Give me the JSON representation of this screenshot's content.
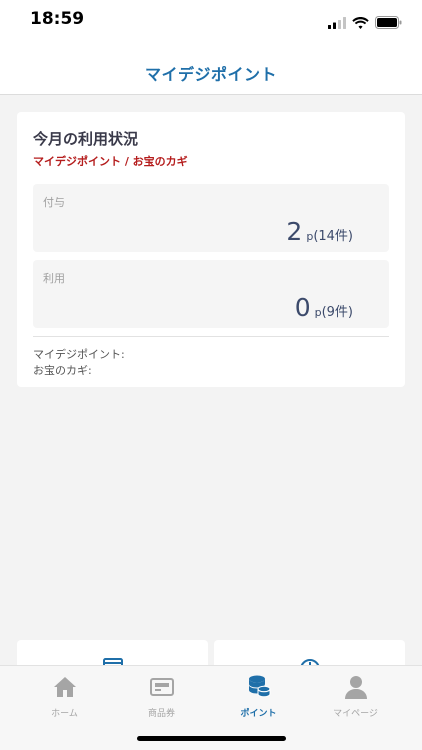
{
  "status_bar": {
    "time": "18:59"
  },
  "header": {
    "title": "マイデジポイント"
  },
  "usage_card": {
    "title": "今月の利用状況",
    "subtitle": "マイデジポイント / お宝のカギ",
    "grant": {
      "label": "付与",
      "value": "2",
      "unit": "p",
      "count": "(14件)"
    },
    "use": {
      "label": "利用",
      "value": "0",
      "unit": "p",
      "count": "(9件)"
    },
    "info_lines": [
      "マイデジポイント:",
      "お宝のカギ:"
    ]
  },
  "tabs": [
    {
      "label": "ホーム",
      "icon": "home-icon",
      "active": false
    },
    {
      "label": "商品券",
      "icon": "gift-card-icon",
      "active": false
    },
    {
      "label": "ポイント",
      "icon": "coins-icon",
      "active": true
    },
    {
      "label": "マイページ",
      "icon": "person-icon",
      "active": false
    }
  ],
  "colors": {
    "accent": "#1f6fa9",
    "subtitle_red": "#b51d1d",
    "value_navy": "#3c4a6b",
    "inactive": "#a5a5a5"
  }
}
